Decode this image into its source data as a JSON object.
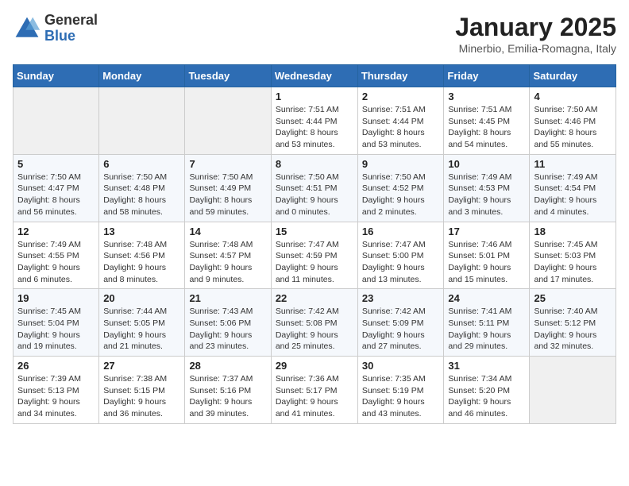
{
  "logo": {
    "general": "General",
    "blue": "Blue"
  },
  "header": {
    "title": "January 2025",
    "subtitle": "Minerbio, Emilia-Romagna, Italy"
  },
  "weekdays": [
    "Sunday",
    "Monday",
    "Tuesday",
    "Wednesday",
    "Thursday",
    "Friday",
    "Saturday"
  ],
  "weeks": [
    [
      {
        "day": "",
        "info": ""
      },
      {
        "day": "",
        "info": ""
      },
      {
        "day": "",
        "info": ""
      },
      {
        "day": "1",
        "info": "Sunrise: 7:51 AM\nSunset: 4:44 PM\nDaylight: 8 hours and 53 minutes."
      },
      {
        "day": "2",
        "info": "Sunrise: 7:51 AM\nSunset: 4:44 PM\nDaylight: 8 hours and 53 minutes."
      },
      {
        "day": "3",
        "info": "Sunrise: 7:51 AM\nSunset: 4:45 PM\nDaylight: 8 hours and 54 minutes."
      },
      {
        "day": "4",
        "info": "Sunrise: 7:50 AM\nSunset: 4:46 PM\nDaylight: 8 hours and 55 minutes."
      }
    ],
    [
      {
        "day": "5",
        "info": "Sunrise: 7:50 AM\nSunset: 4:47 PM\nDaylight: 8 hours and 56 minutes."
      },
      {
        "day": "6",
        "info": "Sunrise: 7:50 AM\nSunset: 4:48 PM\nDaylight: 8 hours and 58 minutes."
      },
      {
        "day": "7",
        "info": "Sunrise: 7:50 AM\nSunset: 4:49 PM\nDaylight: 8 hours and 59 minutes."
      },
      {
        "day": "8",
        "info": "Sunrise: 7:50 AM\nSunset: 4:51 PM\nDaylight: 9 hours and 0 minutes."
      },
      {
        "day": "9",
        "info": "Sunrise: 7:50 AM\nSunset: 4:52 PM\nDaylight: 9 hours and 2 minutes."
      },
      {
        "day": "10",
        "info": "Sunrise: 7:49 AM\nSunset: 4:53 PM\nDaylight: 9 hours and 3 minutes."
      },
      {
        "day": "11",
        "info": "Sunrise: 7:49 AM\nSunset: 4:54 PM\nDaylight: 9 hours and 4 minutes."
      }
    ],
    [
      {
        "day": "12",
        "info": "Sunrise: 7:49 AM\nSunset: 4:55 PM\nDaylight: 9 hours and 6 minutes."
      },
      {
        "day": "13",
        "info": "Sunrise: 7:48 AM\nSunset: 4:56 PM\nDaylight: 9 hours and 8 minutes."
      },
      {
        "day": "14",
        "info": "Sunrise: 7:48 AM\nSunset: 4:57 PM\nDaylight: 9 hours and 9 minutes."
      },
      {
        "day": "15",
        "info": "Sunrise: 7:47 AM\nSunset: 4:59 PM\nDaylight: 9 hours and 11 minutes."
      },
      {
        "day": "16",
        "info": "Sunrise: 7:47 AM\nSunset: 5:00 PM\nDaylight: 9 hours and 13 minutes."
      },
      {
        "day": "17",
        "info": "Sunrise: 7:46 AM\nSunset: 5:01 PM\nDaylight: 9 hours and 15 minutes."
      },
      {
        "day": "18",
        "info": "Sunrise: 7:45 AM\nSunset: 5:03 PM\nDaylight: 9 hours and 17 minutes."
      }
    ],
    [
      {
        "day": "19",
        "info": "Sunrise: 7:45 AM\nSunset: 5:04 PM\nDaylight: 9 hours and 19 minutes."
      },
      {
        "day": "20",
        "info": "Sunrise: 7:44 AM\nSunset: 5:05 PM\nDaylight: 9 hours and 21 minutes."
      },
      {
        "day": "21",
        "info": "Sunrise: 7:43 AM\nSunset: 5:06 PM\nDaylight: 9 hours and 23 minutes."
      },
      {
        "day": "22",
        "info": "Sunrise: 7:42 AM\nSunset: 5:08 PM\nDaylight: 9 hours and 25 minutes."
      },
      {
        "day": "23",
        "info": "Sunrise: 7:42 AM\nSunset: 5:09 PM\nDaylight: 9 hours and 27 minutes."
      },
      {
        "day": "24",
        "info": "Sunrise: 7:41 AM\nSunset: 5:11 PM\nDaylight: 9 hours and 29 minutes."
      },
      {
        "day": "25",
        "info": "Sunrise: 7:40 AM\nSunset: 5:12 PM\nDaylight: 9 hours and 32 minutes."
      }
    ],
    [
      {
        "day": "26",
        "info": "Sunrise: 7:39 AM\nSunset: 5:13 PM\nDaylight: 9 hours and 34 minutes."
      },
      {
        "day": "27",
        "info": "Sunrise: 7:38 AM\nSunset: 5:15 PM\nDaylight: 9 hours and 36 minutes."
      },
      {
        "day": "28",
        "info": "Sunrise: 7:37 AM\nSunset: 5:16 PM\nDaylight: 9 hours and 39 minutes."
      },
      {
        "day": "29",
        "info": "Sunrise: 7:36 AM\nSunset: 5:17 PM\nDaylight: 9 hours and 41 minutes."
      },
      {
        "day": "30",
        "info": "Sunrise: 7:35 AM\nSunset: 5:19 PM\nDaylight: 9 hours and 43 minutes."
      },
      {
        "day": "31",
        "info": "Sunrise: 7:34 AM\nSunset: 5:20 PM\nDaylight: 9 hours and 46 minutes."
      },
      {
        "day": "",
        "info": ""
      }
    ]
  ]
}
